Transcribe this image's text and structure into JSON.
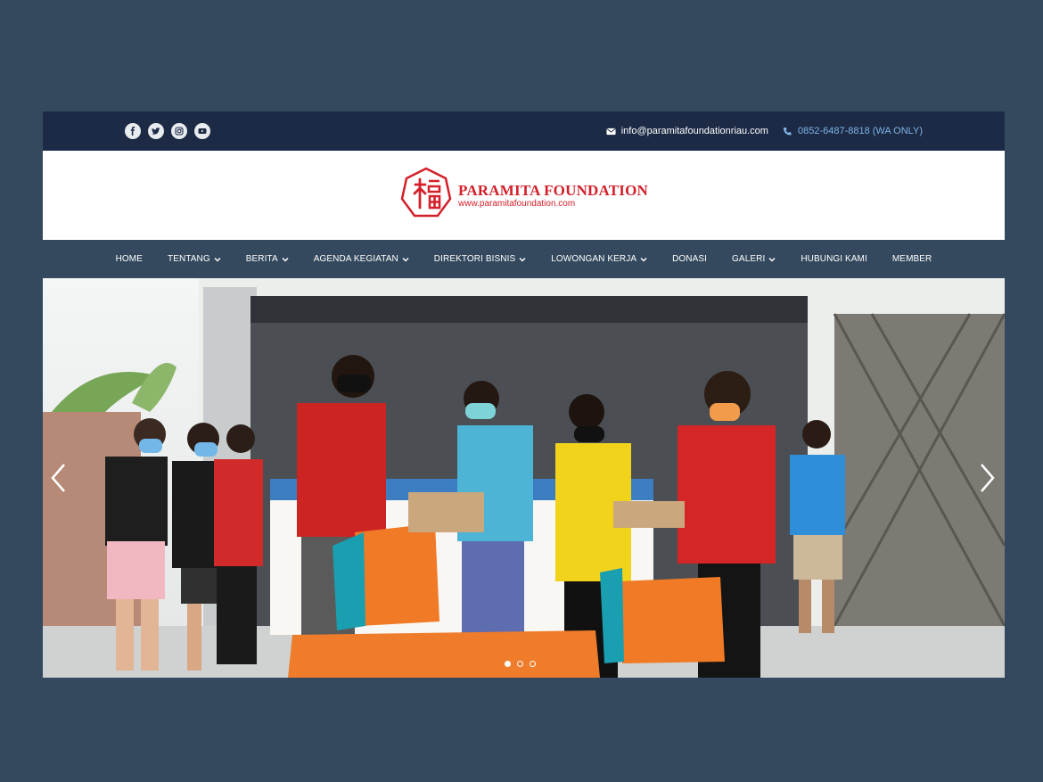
{
  "topbar": {
    "social": [
      {
        "icon": "facebook-icon"
      },
      {
        "icon": "twitter-icon"
      },
      {
        "icon": "instagram-icon"
      },
      {
        "icon": "youtube-icon"
      }
    ],
    "email": "info@paramitafoundationriau.com",
    "phone": "0852-6487-8818 (WA ONLY)"
  },
  "header": {
    "logo_name": "PARAMITA FOUNDATION",
    "logo_url": "www.paramitafoundation.com"
  },
  "nav": {
    "items": [
      {
        "label": "HOME",
        "dropdown": false
      },
      {
        "label": "TENTANG",
        "dropdown": true
      },
      {
        "label": "BERITA",
        "dropdown": true
      },
      {
        "label": "AGENDA KEGIATAN",
        "dropdown": true
      },
      {
        "label": "DIREKTORI BISNIS",
        "dropdown": true
      },
      {
        "label": "LOWONGAN KERJA",
        "dropdown": true
      },
      {
        "label": "DONASI",
        "dropdown": false
      },
      {
        "label": "GALERI",
        "dropdown": true
      },
      {
        "label": "HUBUNGI KAMI",
        "dropdown": false
      },
      {
        "label": "MEMBER",
        "dropdown": false
      }
    ]
  },
  "slider": {
    "slide_count": 3,
    "active_slide": 1
  },
  "colors": {
    "page_bg": "#34495e",
    "topbar_bg": "#1c2a45",
    "nav_bg": "#34495e",
    "brand_red": "#d3202a",
    "phone_text": "#7fb4e6"
  }
}
